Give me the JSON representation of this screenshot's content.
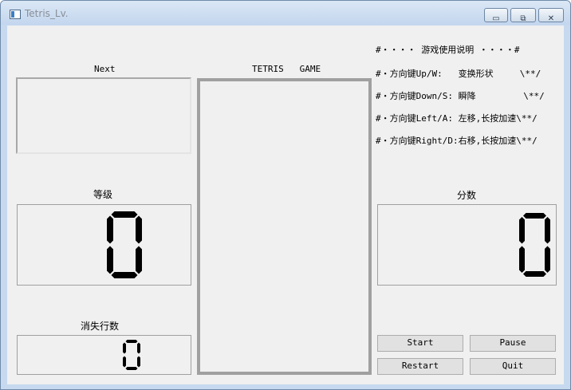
{
  "window": {
    "title": "Tetris_Lv."
  },
  "window_controls": {
    "minimize": "▭",
    "maximize": "⧉",
    "close": "✕"
  },
  "next": {
    "label": "Next"
  },
  "board": {
    "label": "TETRIS   GAME"
  },
  "level": {
    "label": "等级",
    "value": "0"
  },
  "lines": {
    "label": "消失行数",
    "value": "0"
  },
  "score": {
    "label": "分数",
    "value": "0"
  },
  "instructions": [
    "#・・・・ 游戏使用说明 ・・・・#",
    "#・方向键Up/W:   变换形状     \\**/",
    "#・方向键Down/S: 瞬降         \\**/",
    "#・方向键Left/A: 左移,长按加速\\**/",
    "#・方向键Right/D:右移,长按加速\\**/"
  ],
  "buttons": {
    "start": "Start",
    "pause": "Pause",
    "restart": "Restart",
    "quit": "Quit"
  },
  "colors": {
    "lcd_segment": "#000000",
    "window_frame": "#c6d9ef",
    "client_bg": "#f0f0f0"
  }
}
